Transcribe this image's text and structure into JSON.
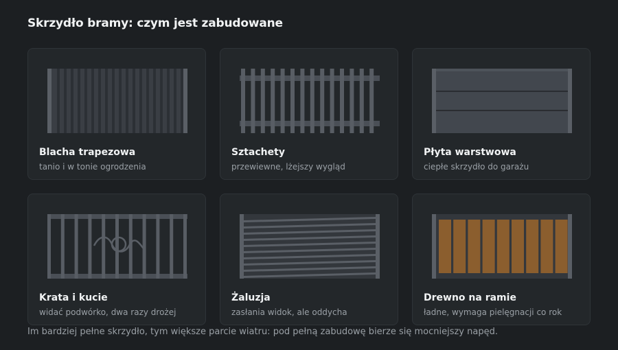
{
  "title": "Skrzydło bramy: czym jest zabudowane",
  "cards": [
    {
      "name": "Blacha trapezowa",
      "desc": "tanio i w tonie ogrodzenia"
    },
    {
      "name": "Sztachety",
      "desc": "przewiewne, lżejszy wygląd"
    },
    {
      "name": "Płyta warstwowa",
      "desc": "ciepłe skrzydło do garażu"
    },
    {
      "name": "Krata i kucie",
      "desc": "widać podwórko, dwa razy drożej"
    },
    {
      "name": "Żaluzja",
      "desc": "zasłania widok, ale oddycha"
    },
    {
      "name": "Drewno na ramie",
      "desc": "ładne, wymaga pielęgnacji co rok"
    }
  ],
  "footer": "Im bardziej pełne skrzydło, tym większe parcie wiatru: pod pełną zabudowę bierze się mocniejszy napęd.",
  "colors": {
    "background": "#1c1f22",
    "card": "#23272a",
    "metal": "#4a4f56",
    "metal_dark": "#33373c",
    "wood": "#8b5e2e"
  }
}
